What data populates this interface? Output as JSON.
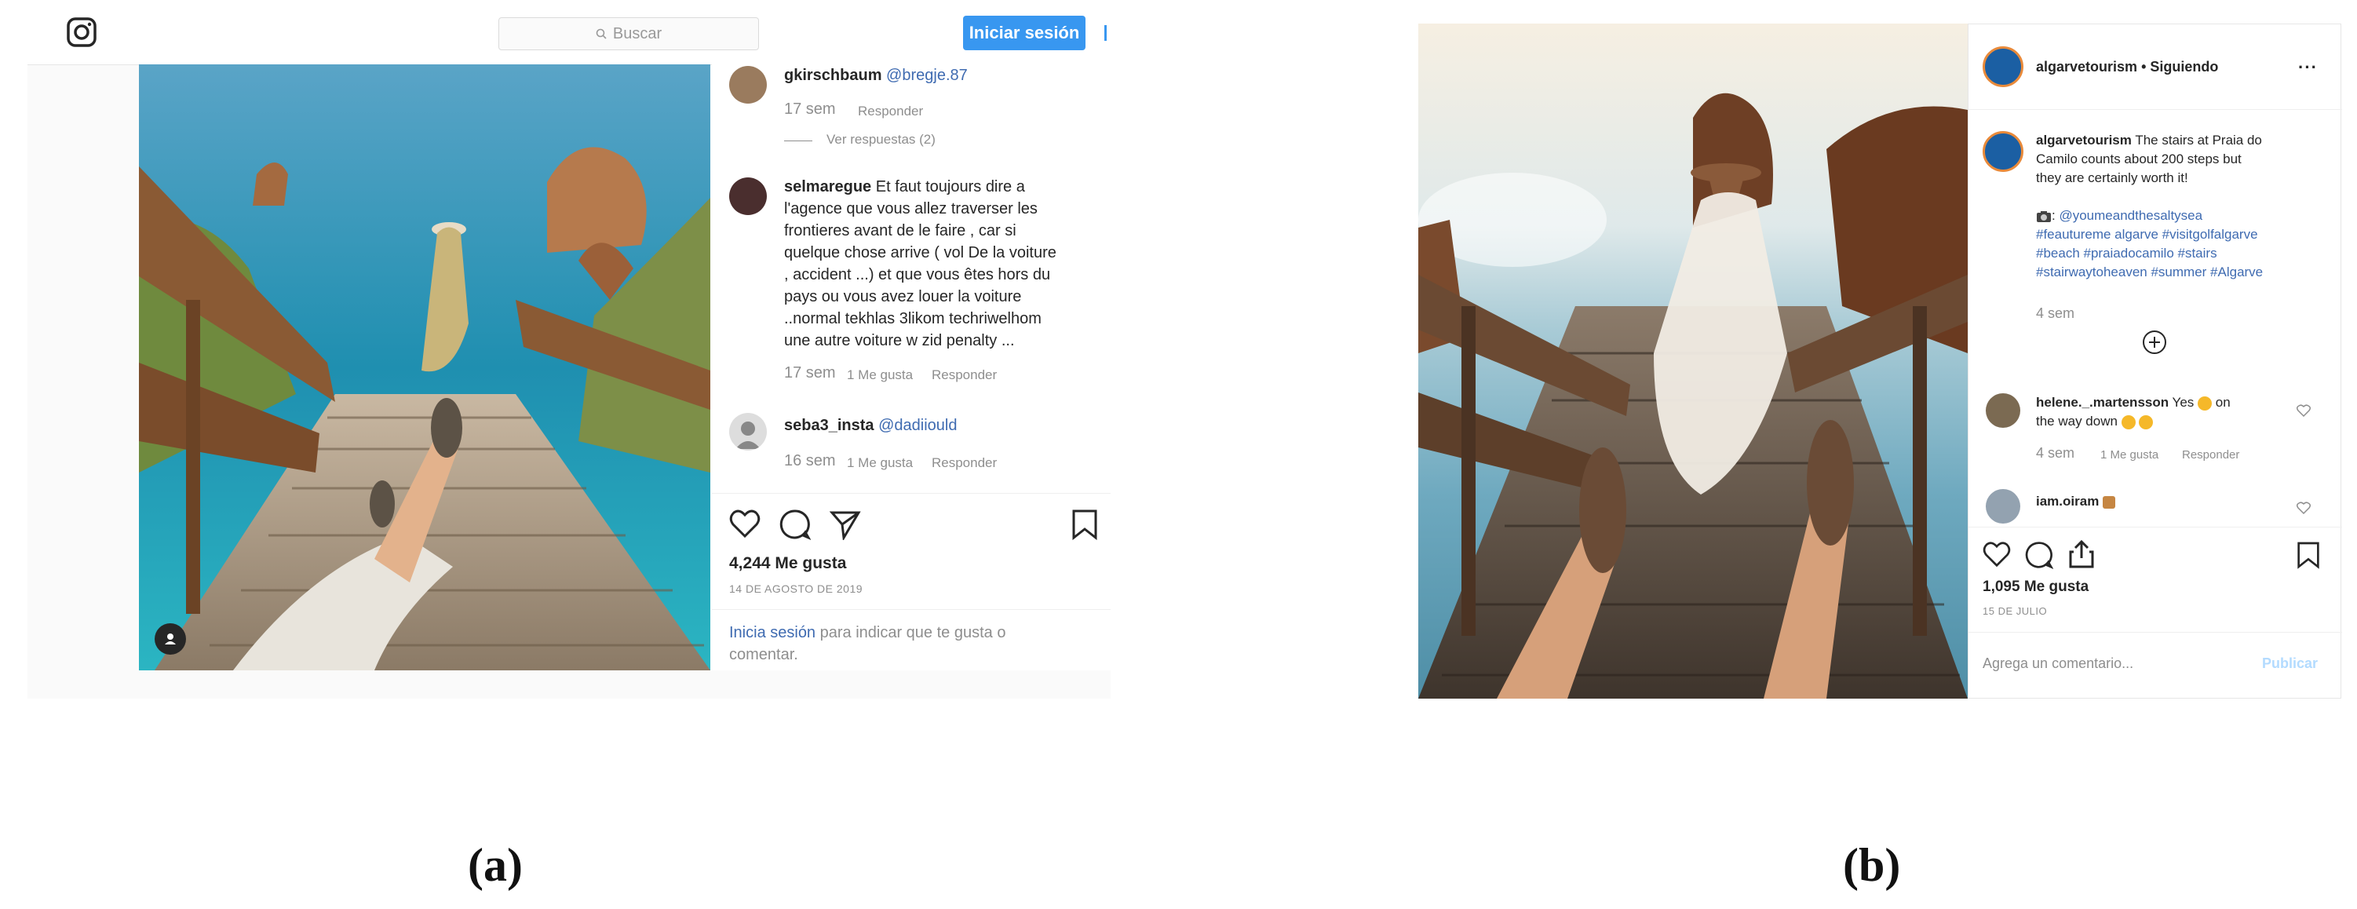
{
  "panel_a": {
    "header": {
      "search_placeholder": "Buscar",
      "login_label": "Iniciar sesión"
    },
    "comments": [
      {
        "username": "gkirschbaum",
        "mention": "@bregje.87",
        "time": "17 sem",
        "reply_label": "Responder",
        "view_replies": "Ver respuestas (2)"
      },
      {
        "username": "selmaregue",
        "text_lines": [
          "Et faut toujours dire a",
          "l'agence que vous allez traverser les",
          "frontieres avant de le faire , car si",
          "quelque chose arrive ( vol De la voiture",
          ", accident ...) et que vous êtes hors du",
          "pays ou vous avez louer la voiture",
          "..normal tekhlas 3likom techriwelhom",
          "une autre voiture w zid penalty ..."
        ],
        "time": "17 sem",
        "likes": "1 Me gusta",
        "reply_label": "Responder"
      },
      {
        "username": "seba3_insta",
        "mention": "@dadiiould",
        "time": "16 sem",
        "likes": "1 Me gusta",
        "reply_label": "Responder"
      }
    ],
    "likes_count": "4,244 Me gusta",
    "date": "14 DE AGOSTO DE 2019",
    "login_prompt": {
      "link": "Inicia sesión",
      "rest_line1": "para indicar que te gusta o",
      "rest_line2": "comentar."
    }
  },
  "panel_b": {
    "header": {
      "username": "algarvetourism",
      "status": "• Siguiendo"
    },
    "caption": {
      "username": "algarvetourism",
      "lines": [
        "The stairs at Praia do",
        "Camilo counts about 200 steps but",
        "they are certainly worth it!"
      ],
      "credit": "@youmeandthesaltysea",
      "hashtag_lines": [
        "#feautureme algarve #visitgolfalgarve",
        "#beach #praiadocamilo #stairs",
        "#stairwaytoheaven #summer #Algarve"
      ],
      "time": "4 sem"
    },
    "comments": [
      {
        "username": "helene._.martensson",
        "text_pre": "Yes",
        "text_post": "on",
        "line2": "the way down",
        "time": "4 sem",
        "likes": "1 Me gusta",
        "reply_label": "Responder"
      },
      {
        "username": "iam.oiram"
      }
    ],
    "likes_count": "1,095 Me gusta",
    "date": "15 DE JULIO",
    "comment_placeholder": "Agrega un comentario...",
    "publish_label": "Publicar"
  },
  "labels": {
    "a": "(a)",
    "b": "(b)"
  },
  "colors": {
    "accent_blue": "#3897f0",
    "link_blue": "#3f6bb1",
    "muted": "#8e8e8e"
  }
}
